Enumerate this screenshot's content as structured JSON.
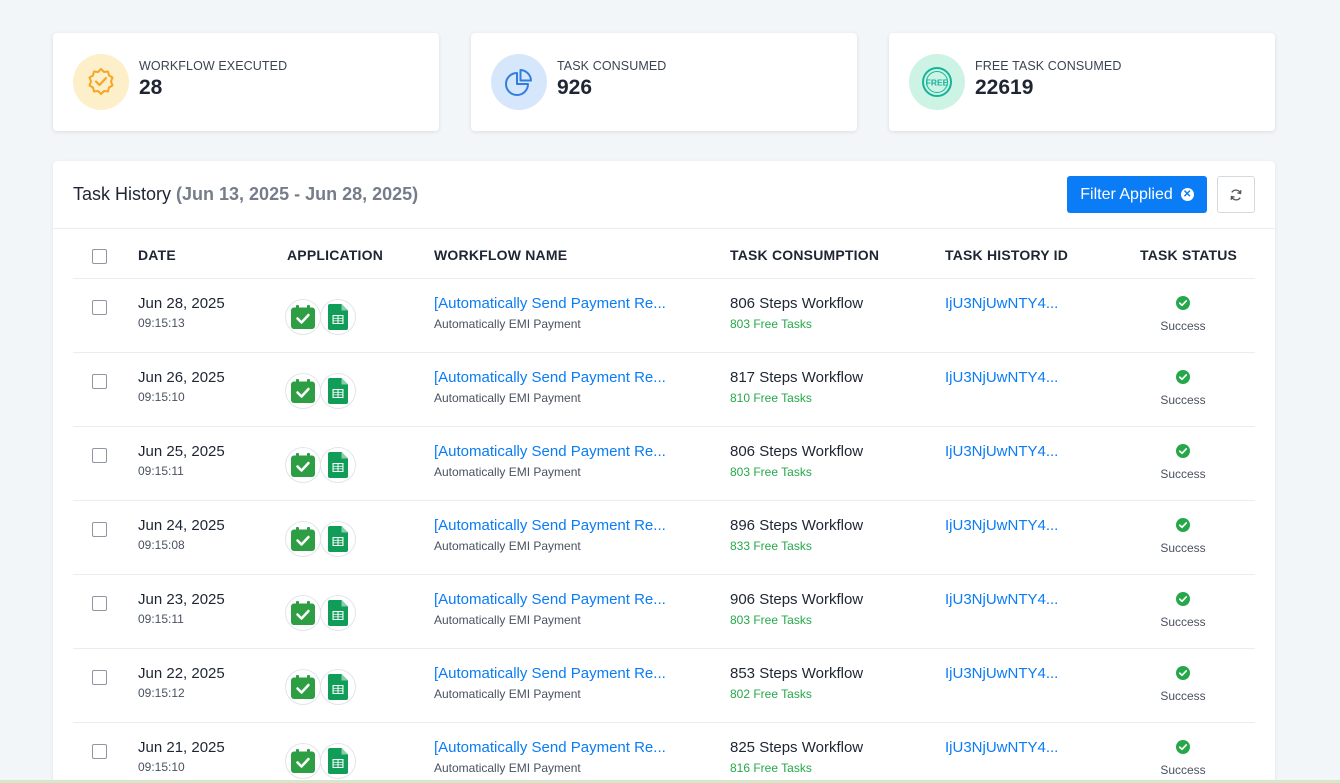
{
  "stats": [
    {
      "label": "WORKFLOW EXECUTED",
      "value": "28",
      "icon": "badge-check-icon",
      "icon_bg": "#fdefc9",
      "icon_color": "#f5a623"
    },
    {
      "label": "TASK CONSUMED",
      "value": "926",
      "icon": "pie-chart-icon",
      "icon_bg": "#d6e7fb",
      "icon_color": "#2f7de1"
    },
    {
      "label": "FREE TASK CONSUMED",
      "value": "22619",
      "icon": "free-badge-icon",
      "icon_bg": "#cdf3e4",
      "icon_color": "#17b39a"
    }
  ],
  "history": {
    "title": "Task History",
    "range": "(Jun 13, 2025 - Jun 28, 2025)",
    "filter_label": "Filter Applied",
    "columns": [
      "DATE",
      "APPLICATION",
      "WORKFLOW NAME",
      "TASK CONSUMPTION",
      "TASK HISTORY ID",
      "TASK STATUS"
    ],
    "rows": [
      {
        "date": "Jun 28, 2025",
        "time": "09:15:13",
        "workflow": "[Automatically Send Payment Re...",
        "workflow_sub": "Automatically EMI Payment",
        "steps": "806 Steps Workflow",
        "free": "803 Free Tasks",
        "id": "IjU3NjUwNTY4...",
        "status": "Success"
      },
      {
        "date": "Jun 26, 2025",
        "time": "09:15:10",
        "workflow": "[Automatically Send Payment Re...",
        "workflow_sub": "Automatically EMI Payment",
        "steps": "817 Steps Workflow",
        "free": "810 Free Tasks",
        "id": "IjU3NjUwNTY4...",
        "status": "Success"
      },
      {
        "date": "Jun 25, 2025",
        "time": "09:15:11",
        "workflow": "[Automatically Send Payment Re...",
        "workflow_sub": "Automatically EMI Payment",
        "steps": "806 Steps Workflow",
        "free": "803 Free Tasks",
        "id": "IjU3NjUwNTY4...",
        "status": "Success"
      },
      {
        "date": "Jun 24, 2025",
        "time": "09:15:08",
        "workflow": "[Automatically Send Payment Re...",
        "workflow_sub": "Automatically EMI Payment",
        "steps": "896 Steps Workflow",
        "free": "833 Free Tasks",
        "id": "IjU3NjUwNTY4...",
        "status": "Success"
      },
      {
        "date": "Jun 23, 2025",
        "time": "09:15:11",
        "workflow": "[Automatically Send Payment Re...",
        "workflow_sub": "Automatically EMI Payment",
        "steps": "906 Steps Workflow",
        "free": "803 Free Tasks",
        "id": "IjU3NjUwNTY4...",
        "status": "Success"
      },
      {
        "date": "Jun 22, 2025",
        "time": "09:15:12",
        "workflow": "[Automatically Send Payment Re...",
        "workflow_sub": "Automatically EMI Payment",
        "steps": "853 Steps Workflow",
        "free": "802 Free Tasks",
        "id": "IjU3NjUwNTY4...",
        "status": "Success"
      },
      {
        "date": "Jun 21, 2025",
        "time": "09:15:10",
        "workflow": "[Automatically Send Payment Re...",
        "workflow_sub": "Automatically EMI Payment",
        "steps": "825 Steps Workflow",
        "free": "816 Free Tasks",
        "id": "IjU3NjUwNTY4...",
        "status": "Success"
      }
    ],
    "app_icons": [
      "google-calendar-icon",
      "google-sheets-icon"
    ],
    "colors": {
      "link": "#0a7cf5",
      "free": "#26a84a",
      "success": "#26a84a"
    }
  }
}
